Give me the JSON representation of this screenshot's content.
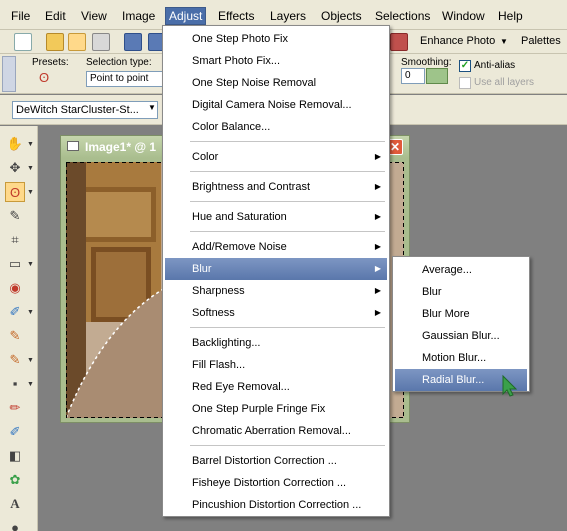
{
  "menubar": [
    "File",
    "Edit",
    "View",
    "Image",
    "Adjust",
    "Effects",
    "Layers",
    "Objects",
    "Selections",
    "Window",
    "Help"
  ],
  "toolbar": {
    "enhance_photo": "Enhance Photo",
    "palettes": "Palettes"
  },
  "options": {
    "presets_label": "Presets:",
    "selection_type_label": "Selection type:",
    "selection_type_value": "Point to point",
    "smoothing_label": "Smoothing:",
    "smoothing_value": "0",
    "antialias_label": "Anti-alias",
    "use_all_layers_label": "Use all layers"
  },
  "font_value": "DeWitch StarCluster-St...",
  "image_window": {
    "title": "Image1* @ 1"
  },
  "adjust_menu": {
    "items": [
      "One Step Photo Fix",
      "Smart Photo Fix...",
      "One Step Noise Removal",
      "Digital Camera Noise Removal...",
      "Color Balance...",
      "Color",
      "Brightness and Contrast",
      "Hue and Saturation",
      "Add/Remove Noise",
      "Blur",
      "Sharpness",
      "Softness",
      "Backlighting...",
      "Fill Flash...",
      "Red Eye Removal...",
      "One Step Purple Fringe Fix",
      "Chromatic Aberration Removal...",
      "Barrel Distortion Correction ...",
      "Fisheye Distortion Correction ...",
      "Pincushion Distortion Correction ..."
    ]
  },
  "blur_menu": {
    "items": [
      "Average...",
      "Blur",
      "Blur More",
      "Gaussian Blur...",
      "Motion Blur...",
      "Radial Blur..."
    ]
  },
  "colors": {
    "highlight": "#5a77ab",
    "menubar_active": "#4a6ea9",
    "chrome": "#ece9d8",
    "workspace": "#808080"
  }
}
